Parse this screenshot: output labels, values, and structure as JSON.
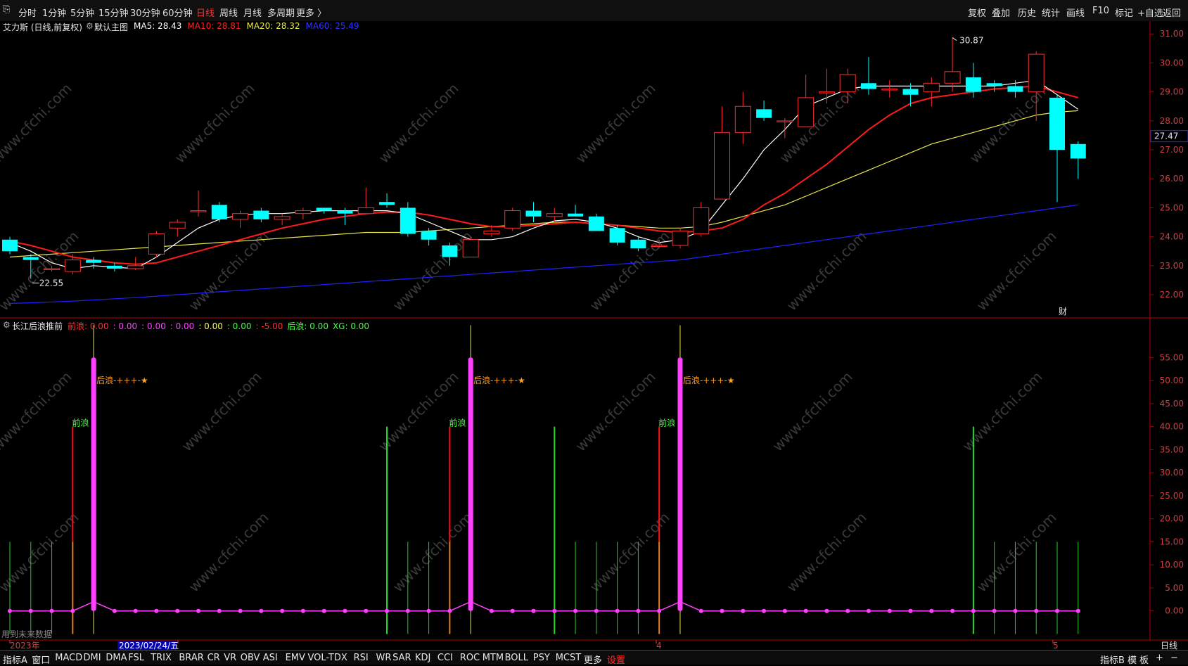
{
  "toolbar": {
    "left_items": [
      "分时",
      "1分钟",
      "5分钟",
      "15分钟",
      "30分钟",
      "60分钟",
      "日线",
      "周线",
      "月线",
      "多周期",
      "更多 〉"
    ],
    "active_index": 6,
    "right_items": [
      "复权",
      "叠加",
      "历史",
      "统计",
      "画线",
      "F10",
      "标记",
      "+自选",
      "返回"
    ]
  },
  "main_chart": {
    "title": "艾力斯 (日线,前复权)",
    "main_label": "默认主图",
    "ma": [
      {
        "label": "MA5: 28.43",
        "color": "#ffffff"
      },
      {
        "label": "MA10: 28.81",
        "color": "#ff2020"
      },
      {
        "label": "MA20: 28.32",
        "color": "#e8e84a"
      },
      {
        "label": "MA60: 25.49",
        "color": "#3030ff"
      }
    ],
    "yticks": [
      "31.00",
      "30.00",
      "29.00",
      "28.00",
      "27.00",
      "26.00",
      "25.00",
      "24.00",
      "23.00",
      "22.00"
    ],
    "current_price": "27.47",
    "high_label": "30.87",
    "low_label": "22.55",
    "fin_marker": "财"
  },
  "chart_data": [
    {
      "type": "candlestick",
      "title": "艾力斯 (日线,前复权)",
      "ylim": [
        21.2,
        31.2
      ],
      "candles": [
        {
          "o": 23.9,
          "h": 24.0,
          "l": 23.4,
          "c": 23.5
        },
        {
          "o": 23.3,
          "h": 23.4,
          "l": 22.55,
          "c": 23.2
        },
        {
          "o": 22.9,
          "h": 23.0,
          "l": 22.8,
          "c": 22.9
        },
        {
          "o": 22.8,
          "h": 23.4,
          "l": 22.7,
          "c": 23.2
        },
        {
          "o": 23.2,
          "h": 23.3,
          "l": 22.9,
          "c": 23.1
        },
        {
          "o": 23.0,
          "h": 23.1,
          "l": 22.8,
          "c": 22.9
        },
        {
          "o": 22.9,
          "h": 23.3,
          "l": 22.85,
          "c": 23.0
        },
        {
          "o": 23.4,
          "h": 24.2,
          "l": 23.3,
          "c": 24.1
        },
        {
          "o": 24.3,
          "h": 24.6,
          "l": 24.0,
          "c": 24.5
        },
        {
          "o": 24.9,
          "h": 25.6,
          "l": 24.7,
          "c": 24.9
        },
        {
          "o": 25.1,
          "h": 25.2,
          "l": 24.5,
          "c": 24.6
        },
        {
          "o": 24.6,
          "h": 24.9,
          "l": 24.3,
          "c": 24.8
        },
        {
          "o": 24.9,
          "h": 25.0,
          "l": 24.5,
          "c": 24.6
        },
        {
          "o": 24.6,
          "h": 24.8,
          "l": 24.4,
          "c": 24.7
        },
        {
          "o": 24.8,
          "h": 25.0,
          "l": 24.6,
          "c": 24.9
        },
        {
          "o": 25.0,
          "h": 25.0,
          "l": 24.8,
          "c": 24.9
        },
        {
          "o": 24.9,
          "h": 25.0,
          "l": 24.4,
          "c": 24.8
        },
        {
          "o": 24.8,
          "h": 25.7,
          "l": 24.8,
          "c": 25.0
        },
        {
          "o": 25.2,
          "h": 25.5,
          "l": 25.0,
          "c": 25.1
        },
        {
          "o": 25.0,
          "h": 25.2,
          "l": 24.0,
          "c": 24.1
        },
        {
          "o": 24.2,
          "h": 24.3,
          "l": 23.7,
          "c": 23.9
        },
        {
          "o": 23.7,
          "h": 23.8,
          "l": 23.0,
          "c": 23.3
        },
        {
          "o": 23.3,
          "h": 24.0,
          "l": 23.3,
          "c": 23.9
        },
        {
          "o": 24.1,
          "h": 24.4,
          "l": 24.0,
          "c": 24.2
        },
        {
          "o": 24.3,
          "h": 25.0,
          "l": 24.2,
          "c": 24.9
        },
        {
          "o": 24.9,
          "h": 25.2,
          "l": 24.5,
          "c": 24.7
        },
        {
          "o": 24.7,
          "h": 25.0,
          "l": 24.5,
          "c": 24.8
        },
        {
          "o": 24.8,
          "h": 25.1,
          "l": 24.7,
          "c": 24.7
        },
        {
          "o": 24.7,
          "h": 24.8,
          "l": 24.2,
          "c": 24.2
        },
        {
          "o": 24.3,
          "h": 24.4,
          "l": 23.7,
          "c": 23.8
        },
        {
          "o": 23.9,
          "h": 24.0,
          "l": 23.5,
          "c": 23.6
        },
        {
          "o": 23.7,
          "h": 23.9,
          "l": 23.6,
          "c": 23.7
        },
        {
          "o": 23.7,
          "h": 24.3,
          "l": 23.6,
          "c": 24.2
        },
        {
          "o": 24.1,
          "h": 25.2,
          "l": 24.0,
          "c": 25.0
        },
        {
          "o": 25.3,
          "h": 28.5,
          "l": 25.3,
          "c": 27.6
        },
        {
          "o": 27.6,
          "h": 29.0,
          "l": 27.2,
          "c": 28.5
        },
        {
          "o": 28.4,
          "h": 28.7,
          "l": 28.0,
          "c": 28.1
        },
        {
          "o": 28.0,
          "h": 28.1,
          "l": 27.4,
          "c": 28.0
        },
        {
          "o": 27.8,
          "h": 29.6,
          "l": 27.8,
          "c": 28.8
        },
        {
          "o": 29.0,
          "h": 29.8,
          "l": 28.6,
          "c": 29.0
        },
        {
          "o": 29.0,
          "h": 29.8,
          "l": 28.6,
          "c": 29.6
        },
        {
          "o": 29.3,
          "h": 30.2,
          "l": 28.9,
          "c": 29.1
        },
        {
          "o": 29.1,
          "h": 29.4,
          "l": 28.8,
          "c": 29.1
        },
        {
          "o": 29.1,
          "h": 29.3,
          "l": 28.5,
          "c": 28.9
        },
        {
          "o": 29.0,
          "h": 29.5,
          "l": 28.5,
          "c": 29.3
        },
        {
          "o": 29.3,
          "h": 30.87,
          "l": 29.0,
          "c": 29.7
        },
        {
          "o": 29.5,
          "h": 30.0,
          "l": 28.8,
          "c": 29.0
        },
        {
          "o": 29.3,
          "h": 29.4,
          "l": 29.0,
          "c": 29.2
        },
        {
          "o": 29.2,
          "h": 29.4,
          "l": 28.8,
          "c": 29.0
        },
        {
          "o": 29.0,
          "h": 30.4,
          "l": 28.0,
          "c": 30.3
        },
        {
          "o": 28.8,
          "h": 28.9,
          "l": 25.2,
          "c": 27.0
        },
        {
          "o": 27.2,
          "h": 27.3,
          "l": 26.0,
          "c": 26.7
        }
      ],
      "ma5": [
        23.8,
        23.5,
        23.1,
        22.9,
        23.0,
        22.95,
        22.9,
        23.3,
        23.8,
        24.3,
        24.6,
        24.75,
        24.8,
        24.8,
        24.85,
        24.9,
        24.9,
        24.9,
        24.9,
        24.8,
        24.5,
        24.2,
        23.9,
        23.9,
        24.0,
        24.3,
        24.55,
        24.6,
        24.5,
        24.3,
        24.0,
        23.8,
        23.9,
        24.2,
        25.1,
        26.0,
        27.0,
        27.7,
        28.5,
        28.8,
        29.1,
        29.2,
        29.2,
        29.2,
        29.2,
        29.2,
        29.2,
        29.2,
        29.3,
        29.4,
        28.9,
        28.4
      ],
      "ma10": [
        23.85,
        23.7,
        23.5,
        23.3,
        23.2,
        23.1,
        23.05,
        23.1,
        23.3,
        23.5,
        23.7,
        23.9,
        24.1,
        24.3,
        24.45,
        24.6,
        24.7,
        24.8,
        24.85,
        24.85,
        24.75,
        24.6,
        24.45,
        24.35,
        24.35,
        24.4,
        24.45,
        24.5,
        24.45,
        24.4,
        24.3,
        24.2,
        24.15,
        24.2,
        24.3,
        24.6,
        25.1,
        25.5,
        26.0,
        26.5,
        27.1,
        27.7,
        28.2,
        28.6,
        28.8,
        28.9,
        29.0,
        29.1,
        29.15,
        29.2,
        29.0,
        28.8
      ],
      "ma20": [
        23.3,
        23.35,
        23.4,
        23.45,
        23.5,
        23.55,
        23.6,
        23.65,
        23.7,
        23.75,
        23.8,
        23.85,
        23.9,
        23.95,
        24.0,
        24.05,
        24.1,
        24.15,
        24.15,
        24.15,
        24.2,
        24.25,
        24.3,
        24.35,
        24.4,
        24.45,
        24.5,
        24.5,
        24.45,
        24.4,
        24.35,
        24.3,
        24.3,
        24.35,
        24.5,
        24.7,
        24.9,
        25.1,
        25.4,
        25.7,
        26.0,
        26.3,
        26.6,
        26.9,
        27.2,
        27.4,
        27.6,
        27.8,
        28.0,
        28.2,
        28.3,
        28.35
      ],
      "ma60": [
        21.7,
        21.72,
        21.75,
        21.78,
        21.82,
        21.86,
        21.9,
        21.95,
        22.0,
        22.05,
        22.1,
        22.15,
        22.2,
        22.25,
        22.3,
        22.35,
        22.4,
        22.45,
        22.5,
        22.55,
        22.6,
        22.65,
        22.7,
        22.75,
        22.8,
        22.85,
        22.9,
        22.95,
        23.0,
        23.05,
        23.1,
        23.15,
        23.2,
        23.3,
        23.4,
        23.5,
        23.6,
        23.7,
        23.8,
        23.9,
        24.0,
        24.1,
        24.2,
        24.3,
        24.4,
        24.5,
        24.6,
        24.7,
        24.8,
        24.9,
        25.0,
        25.1
      ]
    },
    {
      "type": "bar",
      "title": "长江后浪推前",
      "ylim": [
        -6,
        63
      ],
      "categories_count": 52,
      "series": [
        {
          "name": "前浪",
          "values_at": {
            "3": 40,
            "21": 40,
            "31": 40
          },
          "color": "#ff1010"
        },
        {
          "name": "后浪",
          "values_at": {
            "18": 40,
            "26": 40,
            "46": 40
          },
          "color": "#20e020"
        },
        {
          "name": "spike",
          "values_at": {
            "4": 55,
            "22": 55,
            "32": 55
          },
          "color": "#ff40ff"
        },
        {
          "name": "green_short",
          "values_at": {
            "0": 15,
            "1": 15,
            "2": 15,
            "19": 15,
            "20": 15,
            "27": 15,
            "28": 15,
            "29": 15,
            "30": 15,
            "47": 15,
            "48": 15,
            "49": 15,
            "50": 15,
            "51": 15
          },
          "color": "#20e020"
        }
      ],
      "annotations": [
        "前浪",
        "后浪-+++-★"
      ]
    }
  ],
  "indicator": {
    "title": "长江后浪推前",
    "items": [
      {
        "label": "前浪: 0.00",
        "color": "#ff3030"
      },
      {
        "label": ": 0.00",
        "color": "#ff40ff"
      },
      {
        "label": ": 0.00",
        "color": "#ff40ff"
      },
      {
        "label": ": 0.00",
        "color": "#ff40ff"
      },
      {
        "label": ": 0.00",
        "color": "#ffff40"
      },
      {
        "label": ": 0.00",
        "color": "#40ff40"
      },
      {
        "label": ": -5.00",
        "color": "#ff3030"
      },
      {
        "label": "后浪: 0.00",
        "color": "#40ff40"
      },
      {
        "label": "XG: 0.00",
        "color": "#40ff40"
      }
    ],
    "yticks": [
      "55.00",
      "50.00",
      "45.00",
      "40.00",
      "35.00",
      "30.00",
      "25.00",
      "20.00",
      "15.00",
      "10.00",
      "5.00",
      "0.00"
    ],
    "annotation_front": "前浪",
    "annotation_back": "后浪-+++-★",
    "future_data_label": "用到未来数据"
  },
  "time_axis": {
    "year_label": "2023年",
    "cursor_date": "2023/02/24/五",
    "month_4": "4",
    "month_5": "5",
    "period_label": "日线"
  },
  "bottom_tabs": {
    "items": [
      "指标A",
      "窗口",
      "MACD",
      "DMI",
      "DMA",
      "FSL",
      "TRIX",
      "BRAR",
      "CR",
      "VR",
      "OBV",
      "ASI",
      "EMV",
      "VOL-TDX",
      "RSI",
      "WR",
      "SAR",
      "KDJ",
      "CCI",
      "ROC",
      "MTM",
      "BOLL",
      "PSY",
      "MCST",
      "更多",
      "设置"
    ],
    "right_items": [
      "指标B",
      "模",
      "板",
      "+",
      "−"
    ]
  },
  "watermark": "www.cfchi.com"
}
